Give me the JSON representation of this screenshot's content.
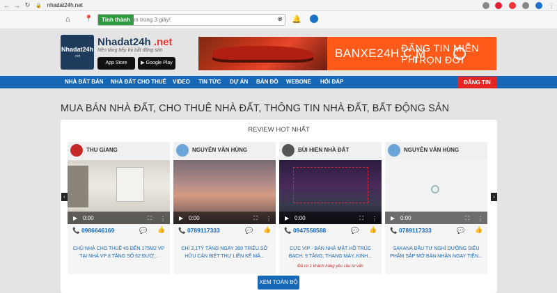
{
  "browser": {
    "url": "nhadat24h.net"
  },
  "topbar": {
    "province_label": "Tỉnh thành",
    "search_placeholder": "Tìm trong 3 giây!"
  },
  "site": {
    "logo_text": "Nhadat24h",
    "logo_sub": ".net",
    "name_main": "Nhadat24h",
    "name_tld": " .net",
    "tagline": "Nền tảng tiếp thị bất động sản"
  },
  "stores": {
    "app_store": "App Store",
    "google_play": "Google Play"
  },
  "banner": {
    "brand": "BANXE24H.C  M",
    "line1": "ĐĂNG TIN MIỄN PHÍ",
    "line2": "TRỌN ĐỜI"
  },
  "menu": {
    "items": [
      "NHÀ ĐẤT BÁN",
      "NHÀ ĐẤT CHO THUÊ",
      "VIDEO",
      "TIN TỨC",
      "DỰ ÁN",
      "BẢN ĐỒ",
      "WEBONE",
      "HỎI ĐÁP"
    ],
    "post_label": "ĐĂNG TIN"
  },
  "heading": "MUA BÁN NHÀ ĐẤT, CHO THUÊ NHÀ ĐẤT, THÔNG TIN NHÀ ĐẤT, BẤT ĐỘNG SẢN",
  "review": {
    "title": "REVIEW HOT NHẤT",
    "more_label": "XEM TOÀN BỘ",
    "cards": [
      {
        "name": "THU GIANG",
        "time": "0:00",
        "phone": "0986646169",
        "desc": "CHỦ NHÀ CHO THUÊ 45 ĐẾN 175M2 VP TẠI NHÀ VP 8 TẦNG SỐ 62 ĐƯỜ...",
        "note": ""
      },
      {
        "name": "NGUYỄN VĂN HÙNG",
        "time": "0:00",
        "phone": "0789117333",
        "desc": "CHỈ 3,1TỶ TẶNG NGAY 300 TRIỆU SỞ HỮU CĂN BIỆT THỰ LIỀN KỀ MÃ...",
        "note": ""
      },
      {
        "name": "BÙI HIỀN NHÀ ĐẤT",
        "time": "0:00",
        "phone": "0947558588",
        "desc": "CỰC VIP - BÁN NHÀ MẶT HỒ TRÚC BẠCH: 9 TẦNG, THANG MÁY, KINH...",
        "note": "Đã có 1 khách hàng yêu cầu tư vấn"
      },
      {
        "name": "NGUYỄN VĂN HÙNG",
        "time": "0:00",
        "phone": "0789117333",
        "desc": "SAKANA ĐẦU TƯ NGHỈ DƯỠNG SIÊU PHẨM SẮP MỞ BÁN NHẬN NGAY TIỀN...",
        "note": ""
      }
    ]
  },
  "colors": {
    "menu_blue": "#1767b7",
    "post_red": "#e52521",
    "province_green": "#2e9b3e"
  }
}
